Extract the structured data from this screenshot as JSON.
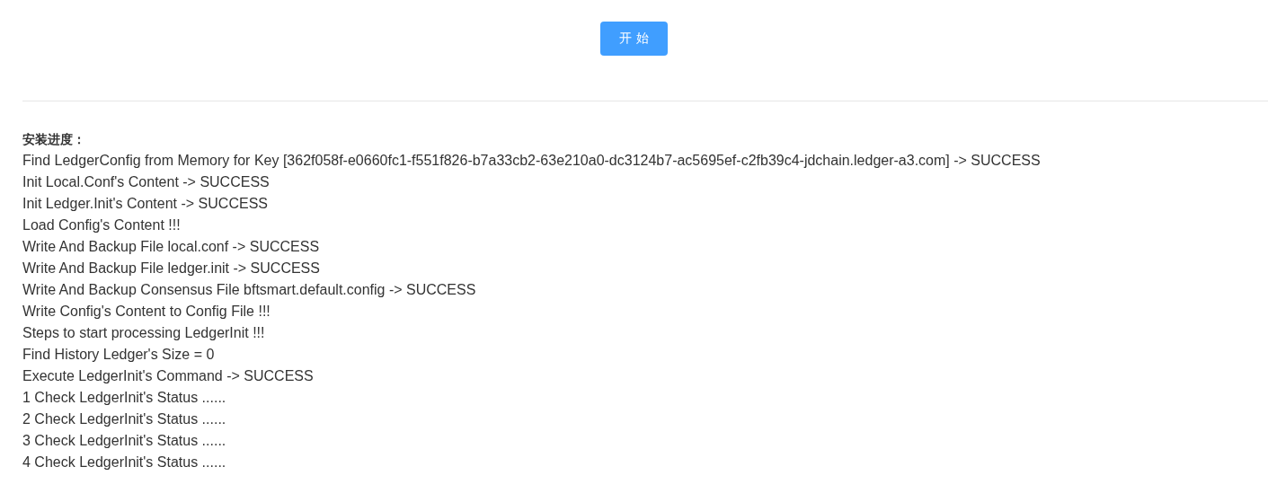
{
  "start_button": {
    "label": "开 始"
  },
  "progress": {
    "heading": "安装进度：",
    "lines": [
      "Find LedgerConfig from Memory for Key [362f058f-e0660fc1-f551f826-b7a33cb2-63e210a0-dc3124b7-ac5695ef-c2fb39c4-jdchain.ledger-a3.com] -> SUCCESS",
      "Init Local.Conf's Content -> SUCCESS",
      "Init Ledger.Init's Content -> SUCCESS",
      "Load Config's Content !!!",
      "Write And Backup File local.conf -> SUCCESS",
      "Write And Backup File ledger.init -> SUCCESS",
      "Write And Backup Consensus File bftsmart.default.config -> SUCCESS",
      "Write Config's Content to Config File !!!",
      "Steps to start processing LedgerInit !!!",
      "Find History Ledger's Size = 0",
      "Execute LedgerInit's Command -> SUCCESS",
      "1 Check LedgerInit's Status ......",
      "2 Check LedgerInit's Status ......",
      "3 Check LedgerInit's Status ......",
      "4 Check LedgerInit's Status ......"
    ]
  }
}
